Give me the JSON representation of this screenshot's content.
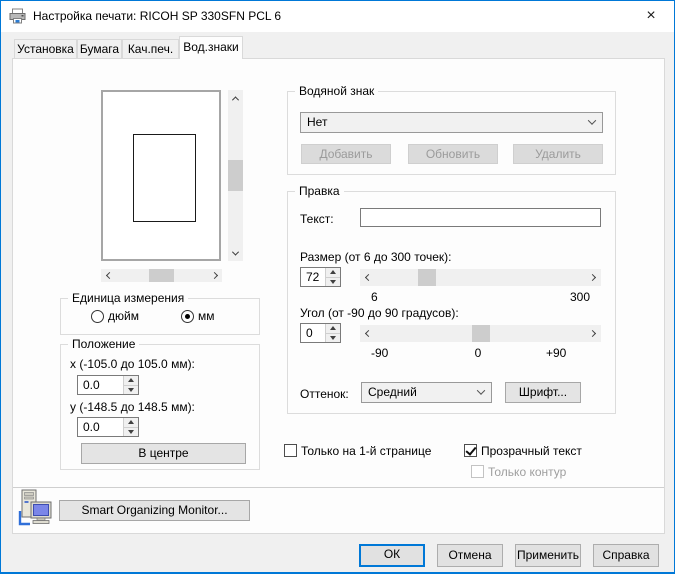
{
  "window": {
    "title": "Настройка печати: RICOH SP 330SFN PCL 6",
    "close_glyph": "×"
  },
  "tabs": {
    "items": [
      {
        "label": "Установка"
      },
      {
        "label": "Бумага"
      },
      {
        "label": "Кач.печ."
      },
      {
        "label": "Вод.знаки"
      }
    ],
    "active_label": "Вод.знаки"
  },
  "unit": {
    "title": "Единица измерения",
    "inch_label": "дюйм",
    "mm_label": "мм",
    "selected": "мм"
  },
  "position": {
    "title": "Положение",
    "x_label": "x (-105.0 до 105.0 мм):",
    "x_value": "0.0",
    "y_label": "y (-148.5 до 148.5 мм):",
    "y_value": "0.0",
    "center_button": "В центре"
  },
  "watermark": {
    "title": "Водяной знак",
    "selected_value": "Нет",
    "add_button": "Добавить",
    "update_button": "Обновить",
    "delete_button": "Удалить"
  },
  "edit": {
    "title": "Правка",
    "text_label": "Текст:",
    "text_value": "",
    "size_label": "Размер (от 6 до 300 точек):",
    "size_value": "72",
    "size_scale_min": "6",
    "size_scale_max": "300",
    "angle_label": "Угол (от -90 до 90 градусов):",
    "angle_value": "0",
    "angle_scale_min": "-90",
    "angle_scale_mid": "0",
    "angle_scale_max": "+90",
    "shade_label": "Оттенок:",
    "shade_value": "Средний",
    "font_button": "Шрифт..."
  },
  "options": {
    "first_page_label": "Только на 1-й странице",
    "first_page_checked": false,
    "transparent_label": "Прозрачный текст",
    "transparent_checked": true,
    "outline_label": "Только контур",
    "outline_checked": false,
    "outline_disabled": true
  },
  "som": {
    "button_label": "Smart Organizing Monitor..."
  },
  "footer": {
    "ok": "ОК",
    "cancel": "Отмена",
    "apply": "Применить",
    "help": "Справка"
  },
  "colors": {
    "accent": "#0078d7",
    "dialog_bg": "#f0f0f0",
    "page_bg": "#fdfdfd"
  }
}
